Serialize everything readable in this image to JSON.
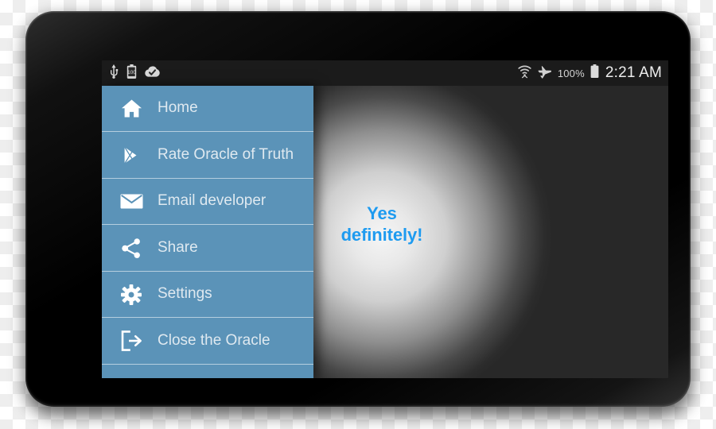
{
  "status_bar": {
    "left_icons": [
      {
        "name": "usb-icon",
        "label": "USB connected"
      },
      {
        "name": "battery-charging-icon",
        "label": "100"
      },
      {
        "name": "cloud-check-icon",
        "label": "Cloud sync complete"
      }
    ],
    "right_icons": [
      {
        "name": "wifi-icon",
        "label": "Wi-Fi"
      },
      {
        "name": "airplane-mode-icon",
        "label": "Airplane mode"
      }
    ],
    "battery_percent": "100%",
    "battery_icon": "battery-full-icon",
    "clock": "2:21 AM"
  },
  "drawer": {
    "items": [
      {
        "id": "home",
        "label": "Home",
        "icon": "home-icon"
      },
      {
        "id": "rate",
        "label": "Rate Oracle of Truth",
        "icon": "google-play-icon"
      },
      {
        "id": "email",
        "label": "Email developer",
        "icon": "envelope-icon"
      },
      {
        "id": "share",
        "label": "Share",
        "icon": "share-icon"
      },
      {
        "id": "settings",
        "label": "Settings",
        "icon": "gear-icon"
      },
      {
        "id": "close",
        "label": "Close the Oracle",
        "icon": "logout-icon"
      }
    ],
    "background_color": "#5b93b8",
    "label_color": "#dfe9f0"
  },
  "content": {
    "answer": "Yes\ndefinitely!",
    "answer_line_1": "Yes",
    "answer_line_2": "definitely!",
    "answer_color": "#1e9bf0"
  }
}
